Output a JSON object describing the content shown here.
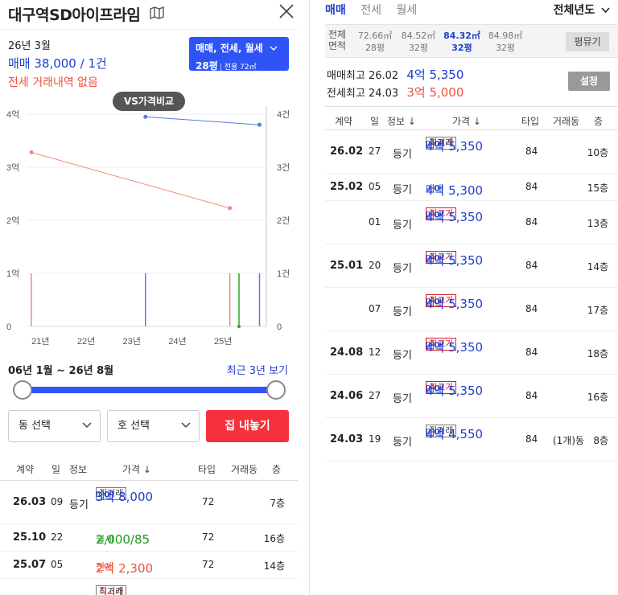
{
  "header": {
    "title": "대구역SD아이프라임"
  },
  "summary": {
    "period": "26년 3월",
    "sale_text": "매매 38,000 / 1건",
    "jeonse_text": "전세 거래내역 없음",
    "type_selector": {
      "line1": "매매, 전세, 월세",
      "line2": "28평",
      "line2_sub": "전용 72㎡"
    }
  },
  "chart_data": {
    "type": "line",
    "compare_button": "VS가격비교",
    "x_ticks": [
      "21년",
      "22년",
      "23년",
      "24년",
      "25년"
    ],
    "y_left_ticks": [
      "0",
      "1억",
      "2억",
      "3억",
      "4억"
    ],
    "y_right_ticks": [
      "0",
      "1건",
      "2건",
      "3건",
      "4건"
    ],
    "ylim_left": [
      0,
      4
    ],
    "ylim_right": [
      0,
      4
    ],
    "xlim": [
      2020.8,
      2025.95
    ],
    "series": [
      {
        "role": "sale",
        "color": "#5b79e0",
        "points": [
          [
            2023.3,
            3.95
          ],
          [
            2025.8,
            3.8
          ]
        ]
      },
      {
        "role": "jeonse",
        "color": "#f08a78",
        "points": [
          [
            2020.8,
            3.28
          ],
          [
            2025.15,
            2.23
          ]
        ]
      }
    ],
    "volume_bars": [
      {
        "x": 2020.8,
        "count": 1,
        "color": "#f08a78"
      },
      {
        "x": 2023.3,
        "count": 1,
        "color": "#5b79e0"
      },
      {
        "x": 2025.15,
        "count": 1,
        "color": "#f08a78"
      },
      {
        "x": 2025.35,
        "count": 1,
        "color": "#2aa52a"
      },
      {
        "x": 2025.8,
        "count": 1,
        "color": "#5b79e0"
      }
    ]
  },
  "range": {
    "label": "06년 1월 ~ 26년 8월",
    "recent_link": "최근 3년 보기",
    "start": 0,
    "end": 1
  },
  "filters": {
    "dong_select": "동 선택",
    "ho_select": "호 선택",
    "gather_button": "집 내놓기"
  },
  "left_table": {
    "headers": {
      "contract": "계약",
      "day": "일",
      "info": "정보",
      "price": "가격 ↓",
      "type": "타입",
      "dong": "거래동",
      "floor": "층"
    },
    "rows": [
      {
        "contract": "26.03",
        "day": "09",
        "info": "등기",
        "badges": [
          "직거래"
        ],
        "kind": "매매",
        "amount": "3억 8,000",
        "tone": "blue",
        "type": "72",
        "floor": "7층"
      },
      {
        "contract": "25.10",
        "day": "22",
        "info": "",
        "badges": [],
        "kind": "월세",
        "amount": "2,000/85",
        "tone": "green",
        "type": "72",
        "floor": "16층"
      },
      {
        "contract": "25.07",
        "day": "05",
        "info": "",
        "badges": [],
        "kind": "전세",
        "amount": "2억 2,300",
        "tone": "orange",
        "type": "72",
        "floor": "14층"
      }
    ],
    "partial_badges": [
      "최고가",
      "직거래"
    ]
  },
  "right": {
    "tabs": [
      "매매",
      "전세",
      "월세"
    ],
    "year_select": "전체년도",
    "area_header": [
      "전체",
      "면적"
    ],
    "areas": [
      {
        "sqm": "72.66㎡",
        "py": "28평"
      },
      {
        "sqm": "84.52㎡",
        "py": "32평"
      },
      {
        "sqm": "84.32㎡",
        "py": "32평"
      },
      {
        "sqm": "84.98㎡",
        "py": "32평"
      }
    ],
    "pyeong_button": "평뮤기",
    "max_sale": {
      "label": "매매최고",
      "date": "26.02",
      "value": "4억 5,350"
    },
    "max_jeonse": {
      "label": "전세최고",
      "date": "24.03",
      "value": "3억 5,000"
    },
    "settings_button": "설정",
    "headers": {
      "contract": "계약",
      "day": "일",
      "info": "정보 ↓",
      "price": "가격 ↓",
      "type": "타입",
      "dong": "거래동",
      "floor": "층"
    },
    "rows": [
      {
        "contract": "26.02",
        "day": "27",
        "info": "등기",
        "badges": [
          "최고가",
          "직거래"
        ],
        "kind": "매매",
        "amount": "4억 5,350",
        "type": "84",
        "dong": "",
        "floor": "10층"
      },
      {
        "contract": "25.02",
        "day": "05",
        "info": "등기",
        "badges": [],
        "kind": "매매",
        "amount": "4억 5,300",
        "type": "84",
        "dong": "",
        "floor": "15층"
      },
      {
        "contract": "",
        "day": "01",
        "info": "등기",
        "badges": [
          "최고가"
        ],
        "kind": "매매",
        "amount": "4억 5,350",
        "type": "84",
        "dong": "",
        "floor": "13층"
      },
      {
        "contract": "25.01",
        "day": "20",
        "info": "등기",
        "badges": [
          "최고가"
        ],
        "kind": "매매",
        "amount": "4억 5,350",
        "type": "84",
        "dong": "",
        "floor": "14층"
      },
      {
        "contract": "",
        "day": "07",
        "info": "등기",
        "badges": [
          "최고가"
        ],
        "kind": "매매",
        "amount": "4억 5,350",
        "type": "84",
        "dong": "",
        "floor": "17층"
      },
      {
        "contract": "24.08",
        "day": "12",
        "info": "등기",
        "badges": [
          "최고가"
        ],
        "kind": "매매",
        "amount": "4억 5,350",
        "type": "84",
        "dong": "",
        "floor": "18층"
      },
      {
        "contract": "24.06",
        "day": "27",
        "info": "등기",
        "badges": [
          "최고가"
        ],
        "kind": "매매",
        "amount": "4억 5,350",
        "type": "84",
        "dong": "",
        "floor": "16층"
      },
      {
        "contract": "24.03",
        "day": "19",
        "info": "등기",
        "badges": [
          "직거래"
        ],
        "kind": "매매",
        "amount": "4억 4,550",
        "type": "84",
        "dong": "(1개)동",
        "floor": "8층"
      }
    ]
  }
}
